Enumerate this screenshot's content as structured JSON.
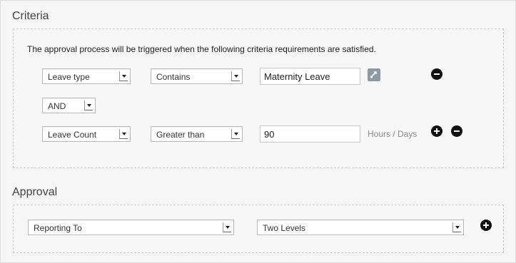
{
  "criteria": {
    "title": "Criteria",
    "intro": "The approval process will be triggered when the following criteria requirements are satisfied.",
    "row1": {
      "field": "Leave type",
      "operator": "Contains",
      "value": "Maternity Leave"
    },
    "conjunction": "AND",
    "row2": {
      "field": "Leave Count",
      "operator": "Greater than",
      "value": "90",
      "unit": "Hours / Days"
    }
  },
  "approval": {
    "title": "Approval",
    "approver": "Reporting To",
    "levels": "Two Levels"
  },
  "colors": {
    "button": "#111111",
    "lookup_icon": "#8d9aa3"
  }
}
